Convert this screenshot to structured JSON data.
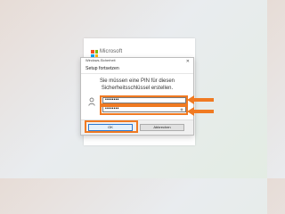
{
  "background_window": {
    "brand": "Microsoft",
    "logo_colors": [
      "#f25022",
      "#7fba00",
      "#00a4ef",
      "#ffb900"
    ]
  },
  "dialog": {
    "title": "Windows-Sicherheit",
    "heading": "Setup fortsetzen",
    "message_line1": "Sie müssen eine PIN für diesen",
    "message_line2": "Sicherheitsschlüssel erstellen.",
    "pin_value": "••••••••",
    "pin_confirm_value": "••••••••",
    "ok_label": "OK",
    "cancel_label": "Abbrechen",
    "user_icon": "person-icon",
    "close_icon": "close-icon"
  },
  "annotations": {
    "color": "#f07a22"
  }
}
